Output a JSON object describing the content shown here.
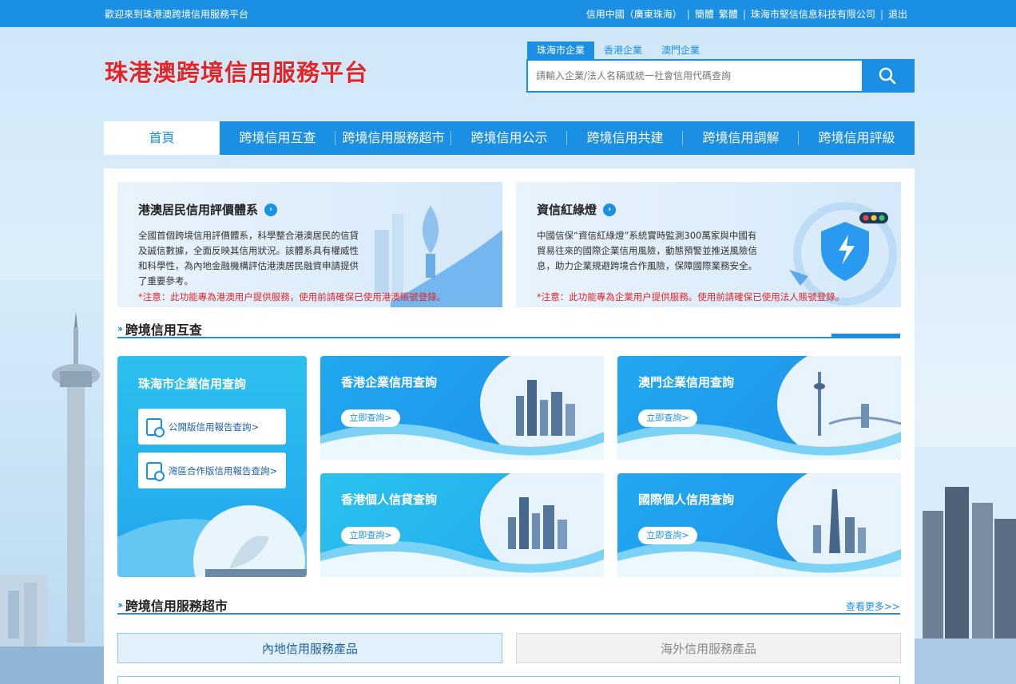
{
  "topbar": {
    "welcome": "歡迎來到珠港澳跨境信用服務平台",
    "region": "信用中國（廣東珠海）",
    "lang_simplified": "簡體",
    "lang_traditional": "繁體",
    "company": "珠海市堅信信息科技有限公司",
    "logout": "退出",
    "sep": "|"
  },
  "header": {
    "logo": "珠港澳跨境信用服務平台",
    "search_tabs": [
      "珠海市企業",
      "香港企業",
      "澳門企業"
    ],
    "search_placeholder": "請輸入企業/法人名稱或統一社會信用代碼查詢"
  },
  "nav": [
    "首頁",
    "跨境信用互查",
    "跨境信用服務超市",
    "跨境信用公示",
    "跨境信用共建",
    "跨境信用調解",
    "跨境信用評級"
  ],
  "features": [
    {
      "title": "港澳居民信用評價體系",
      "desc": "全國首個跨境信用評價體系，科學整合港澳居民的信貸及誠信數據，全面反映其信用狀況。該體系具有權威性和科學性，為內地金融機構評估港澳居民融資申請提供了重要參考。",
      "note": "*注意：此功能專為港澳用户提供服務，使用前請確保已使用港澳賬號登錄。"
    },
    {
      "title": "資信紅綠燈",
      "desc": "中國信保“資信紅綠燈”系統實時監測300萬家與中國有貿易往來的國際企業信用風險，動態預警並推送風險信息，助力企業規避跨境合作風險，保障國際業務安全。",
      "note": "*注意：此功能專為企業用户提供服務。使用前請確保已使用法人賬號登錄。"
    }
  ],
  "sections": {
    "mutual": "跨境信用互查",
    "market": "跨境信用服務超市",
    "more": "查看更多>>",
    "chev": "››"
  },
  "zhuhai": {
    "title": "珠海市企業信用查詢",
    "btn1": "公開版信用報告查詢>",
    "btn2": "灣區合作版信用報告查詢>"
  },
  "cards": [
    {
      "title": "香港企業信用查詢",
      "btn": "立即查詢>"
    },
    {
      "title": "澳門企業信用查詢",
      "btn": "立即查詢>"
    },
    {
      "title": "香港個人信貸查詢",
      "btn": "立即查詢>"
    },
    {
      "title": "國際個人信用查詢",
      "btn": "立即查詢>"
    }
  ],
  "market_tabs": [
    "內地信用服務產品",
    "海外信用服務產品"
  ],
  "colors": {
    "primary": "#1b8fe4",
    "logo_red": "#e0262a",
    "warning": "#e0262a"
  }
}
